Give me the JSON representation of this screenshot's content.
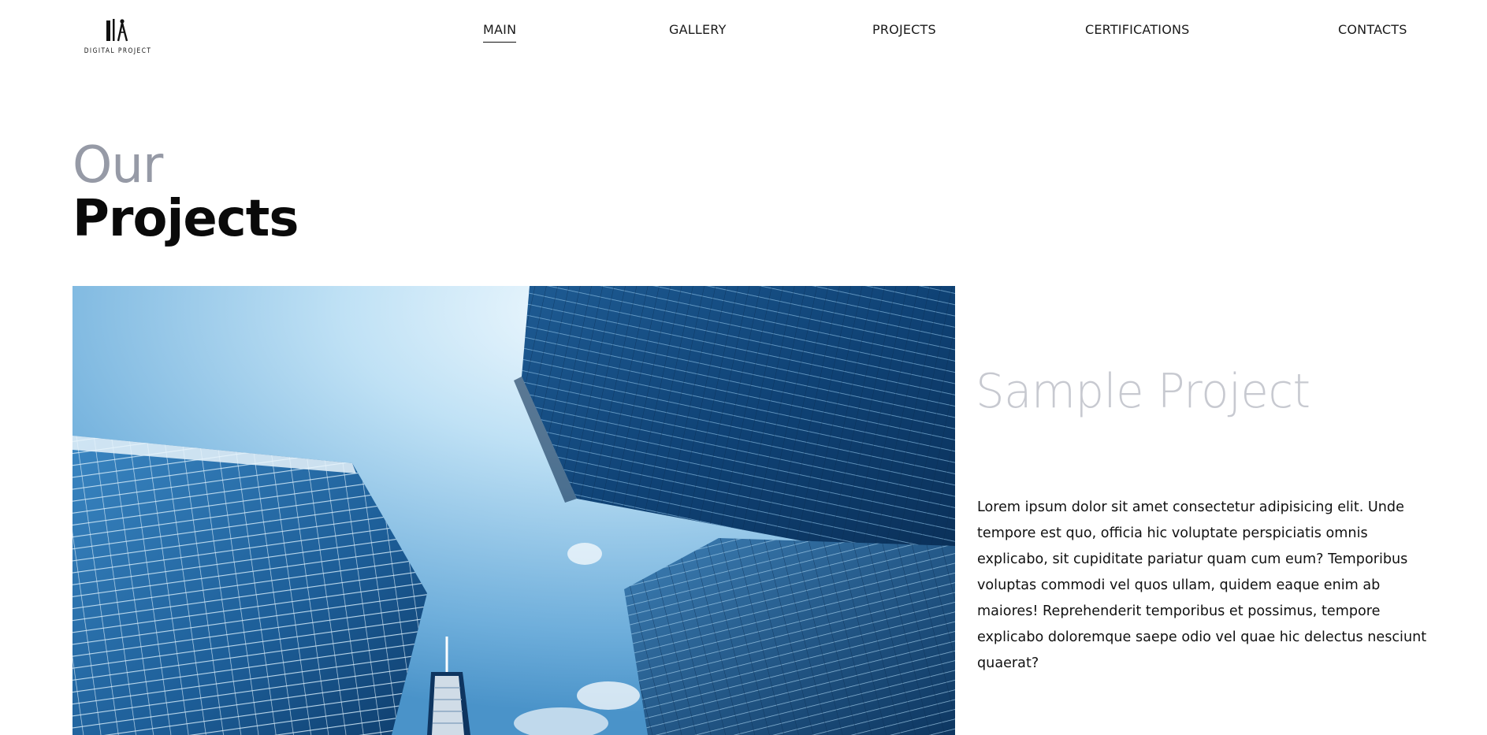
{
  "brand": {
    "logo_text": "DIGITAL PROJECT"
  },
  "nav": {
    "items": [
      {
        "label": "MAIN",
        "active": true
      },
      {
        "label": "GALLERY",
        "active": false
      },
      {
        "label": "PROJECTS",
        "active": false
      },
      {
        "label": "CERTIFICATIONS",
        "active": false
      },
      {
        "label": "CONTACTS",
        "active": false
      }
    ]
  },
  "hero": {
    "heading_light": "Our",
    "heading_bold": "Projects"
  },
  "project": {
    "title": "Sample Project",
    "description": "Lorem ipsum dolor sit amet consectetur adipisicing elit. Unde tempore est quo, officia hic voluptate perspiciatis omnis explicabo, sit cupiditate pariatur quam cum eum? Temporibus voluptas commodi vel quos ullam, quidem eaque enim ab maiores! Reprehenderit temporibus et possimus, tempore explicabo doloremque saepe odio vel quae hic delectus nesciunt quaerat?",
    "image_icon": "skyscrapers-photo"
  },
  "colors": {
    "heading_light": "#969aa6",
    "project_title": "#c7c9d0",
    "sky": "#8fc4e6",
    "building_dark": "#0d3a66"
  }
}
